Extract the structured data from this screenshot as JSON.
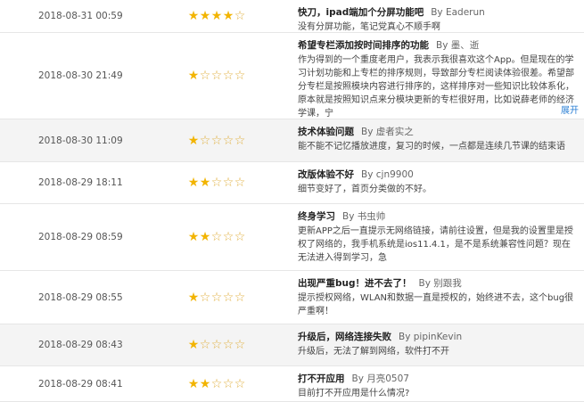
{
  "reviews": [
    {
      "date": "2018-08-31 00:59",
      "rating": 4,
      "title": "快刀，ipad端加个分屏功能吧",
      "author": "By Eaderun",
      "content": "没有分屏功能，笔记党真心不顺手啊",
      "alt": false
    },
    {
      "date": "2018-08-30 21:49",
      "rating": 1,
      "title": "希望专栏添加按时间排序的功能",
      "author": "By 墨、逝",
      "content": "作为得到的一个重度老用户，我表示我很喜欢这个App。但是现在的学习计划功能和上专栏的排序规则，导致部分专栏阅读体验很差。希望部分专栏是按照模块内容进行排序的，这样排序对一些知识比较体系化，原本就是按照知识点来分模块更新的专栏很好用，比如说薛老师的经济学课，宁",
      "expand": "展开",
      "alt": false
    },
    {
      "date": "2018-08-30 11:09",
      "rating": 1,
      "title": "技术体验问题",
      "author": "By 虚者实之",
      "content": "能不能不记忆播放进度，复习的时候，一点都是连续几节课的结束语",
      "alt": true
    },
    {
      "date": "2018-08-29 18:11",
      "rating": 2,
      "title": "改版体验不好",
      "author": "By cjn9900",
      "content": "细节变好了，首页分类做的不好。",
      "alt": false
    },
    {
      "date": "2018-08-29 08:59",
      "rating": 2,
      "title": "终身学习",
      "author": "By 书虫帅",
      "content": "更新APP之后一直提示无网络链接，请前往设置，但是我的设置里是授权了网络的，我手机系统是ios11.4.1，是不是系统兼容性问题？现在无法进入得到学习，急",
      "alt": false
    },
    {
      "date": "2018-08-29 08:55",
      "rating": 1,
      "title": "出现严重bug！进不去了！",
      "author": "By 别跟我",
      "content": "提示授权网络，WLAN和数据一直是授权的，始终进不去，这个bug很严重啊！",
      "alt": false
    },
    {
      "date": "2018-08-29 08:43",
      "rating": 1,
      "title": "升级后，网络连接失败",
      "author": "By pipinKevin",
      "content": "升级后，无法了解到网络，软件打不开",
      "alt": true
    },
    {
      "date": "2018-08-29 08:41",
      "rating": 2,
      "title": "打不开应用",
      "author": "By 月亮0507",
      "content": "目前打不开应用是什么情况?",
      "alt": false
    }
  ],
  "star_colors": {
    "on": "#f2b400",
    "off": "#e0b040"
  },
  "star_glyph_on": "★",
  "star_glyph_off": "☆"
}
